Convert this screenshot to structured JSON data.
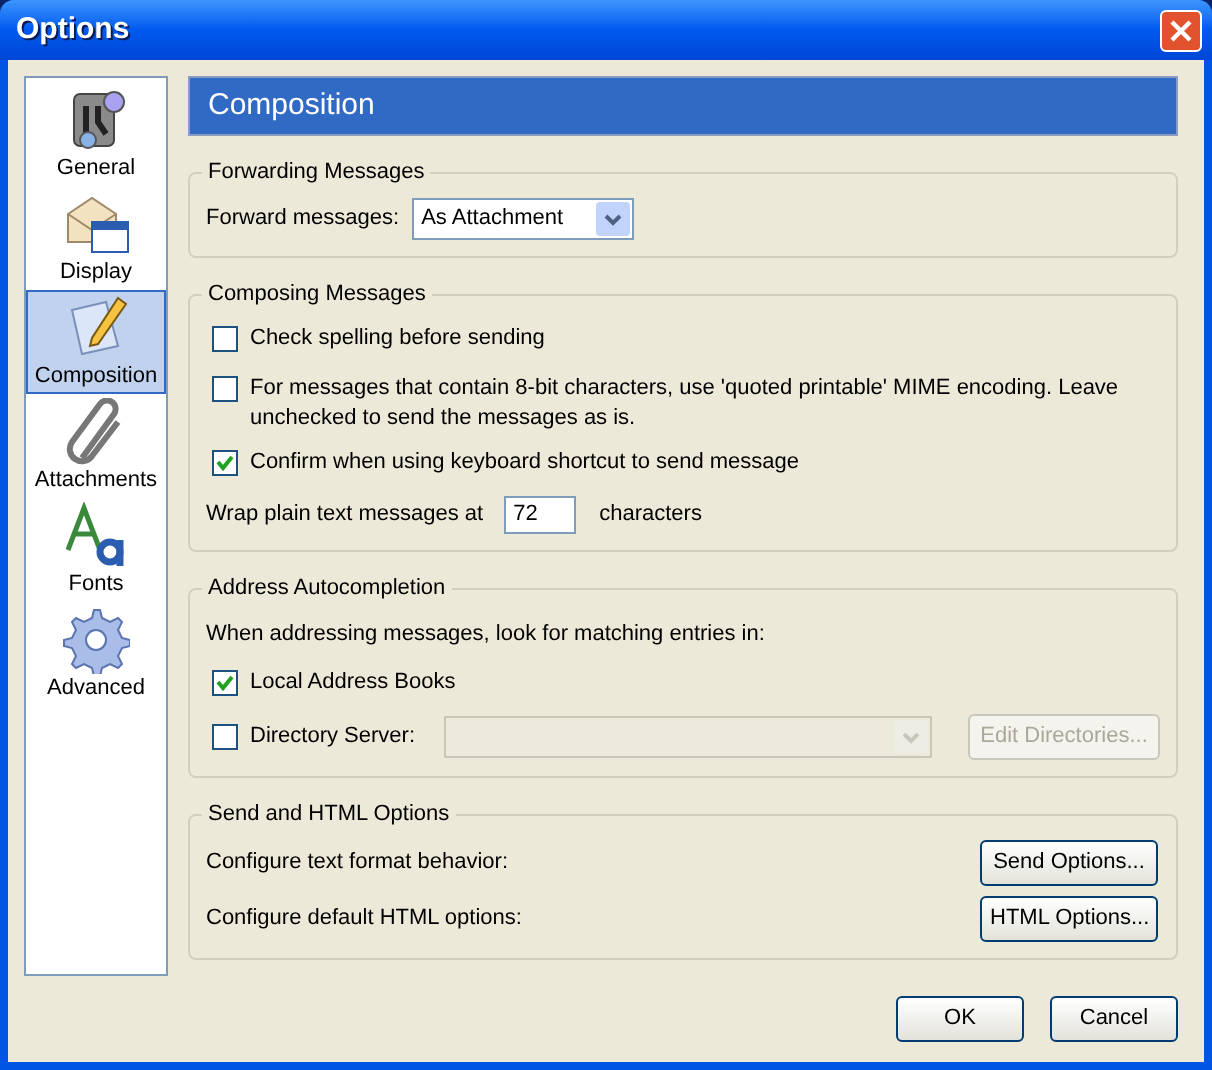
{
  "window": {
    "title": "Options"
  },
  "sidebar": {
    "items": [
      {
        "label": "General",
        "selected": false
      },
      {
        "label": "Display",
        "selected": false
      },
      {
        "label": "Composition",
        "selected": true
      },
      {
        "label": "Attachments",
        "selected": false
      },
      {
        "label": "Fonts",
        "selected": false
      },
      {
        "label": "Advanced",
        "selected": false
      }
    ]
  },
  "header": {
    "title": "Composition"
  },
  "sections": [
    {
      "title": "Forwarding Messages",
      "rows": [
        {
          "kind": "select",
          "label": "Forward messages:",
          "value": "As Attachment"
        }
      ]
    },
    {
      "title": "Composing Messages",
      "rows": [
        {
          "kind": "checkbox",
          "label": "Check spelling before sending",
          "checked": false
        },
        {
          "kind": "checkbox",
          "label": "For messages that contain 8-bit characters, use 'quoted printable' MIME encoding. Leave unchecked to send the messages as is.",
          "checked": false
        },
        {
          "kind": "checkbox",
          "label": "Confirm when using keyboard shortcut to send message",
          "checked": true
        },
        {
          "kind": "input",
          "label": "Wrap plain text messages at",
          "value": "72",
          "suffix": "characters"
        }
      ]
    },
    {
      "title": "Address Autocompletion",
      "rows": [
        {
          "kind": "text",
          "label": "When addressing messages, look for matching entries in:"
        },
        {
          "kind": "checkbox",
          "label": "Local Address Books",
          "checked": true
        },
        {
          "kind": "directory",
          "label": "Directory Server:",
          "checked": false,
          "disabled": true,
          "button": "Edit Directories..."
        }
      ]
    },
    {
      "title": "Send and HTML Options",
      "rows": [
        {
          "kind": "button",
          "label": "Configure text format behavior:",
          "button": "Send Options..."
        },
        {
          "kind": "button",
          "label": "Configure default HTML options:",
          "button": "HTML Options..."
        }
      ]
    }
  ],
  "buttons": [
    "OK",
    "Cancel"
  ]
}
